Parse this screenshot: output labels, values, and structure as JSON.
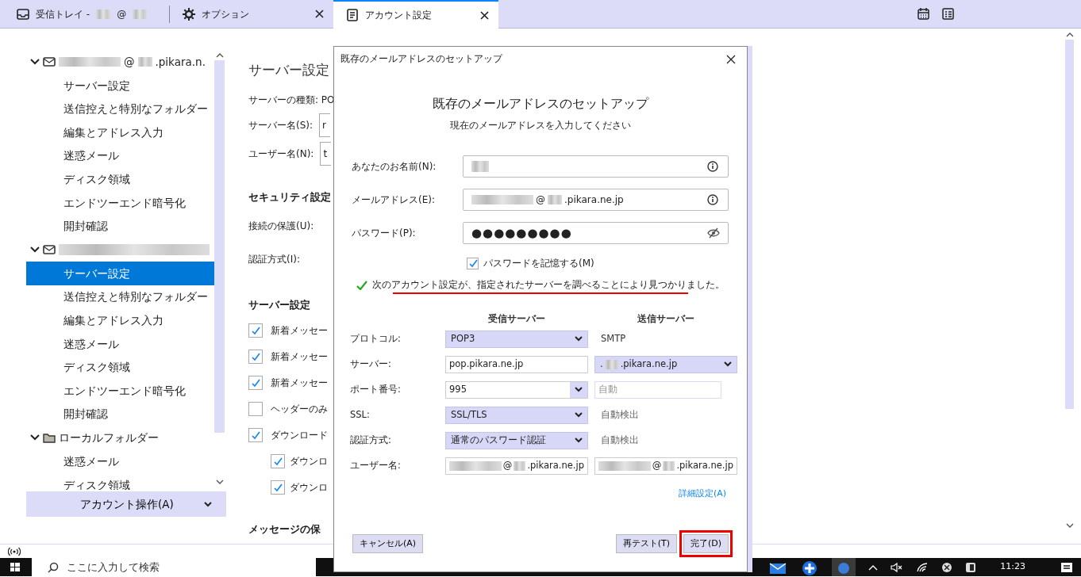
{
  "tabs": [
    {
      "segments": [
        {
          "kind": "text",
          "text": "受信トレイ -"
        },
        {
          "kind": "blur"
        },
        {
          "kind": "text",
          "text": "@"
        },
        {
          "kind": "blur"
        }
      ],
      "closable": false,
      "selected": false
    },
    {
      "segments": [
        {
          "kind": "text",
          "text": "オプション"
        }
      ],
      "closable": true,
      "selected": false
    },
    {
      "segments": [
        {
          "kind": "text",
          "text": "アカウント設定"
        }
      ],
      "closable": true,
      "selected": true
    }
  ],
  "sidebar": {
    "tree": [
      {
        "kind": "account",
        "expanded": true,
        "segments": [
          {
            "kind": "blur"
          },
          {
            "kind": "text",
            "text": "@"
          },
          {
            "kind": "blur"
          },
          {
            "kind": "text",
            "text": ".pikara.n."
          }
        ],
        "children": [
          {
            "label": "サーバー設定",
            "selected": false
          },
          {
            "label": "送信控えと特別なフォルダー",
            "selected": false
          },
          {
            "label": "編集とアドレス入力",
            "selected": false
          },
          {
            "label": "迷惑メール",
            "selected": false
          },
          {
            "label": "ディスク領域",
            "selected": false
          },
          {
            "label": "エンドツーエンド暗号化",
            "selected": false
          },
          {
            "label": "開封確認",
            "selected": false
          }
        ]
      },
      {
        "kind": "account",
        "expanded": true,
        "segments": [
          {
            "kind": "blur"
          }
        ],
        "children": [
          {
            "label": "サーバー設定",
            "selected": true
          },
          {
            "label": "送信控えと特別なフォルダー",
            "selected": false
          },
          {
            "label": "編集とアドレス入力",
            "selected": false
          },
          {
            "label": "迷惑メール",
            "selected": false
          },
          {
            "label": "ディスク領域",
            "selected": false
          },
          {
            "label": "エンドツーエンド暗号化",
            "selected": false
          },
          {
            "label": "開封確認",
            "selected": false
          }
        ]
      },
      {
        "kind": "folder",
        "expanded": true,
        "segments": [
          {
            "kind": "text",
            "text": "ローカルフォルダー"
          }
        ],
        "children": [
          {
            "label": "迷惑メール",
            "selected": false
          },
          {
            "label": "ディスク領域",
            "selected": false
          }
        ]
      }
    ],
    "action_button": "アカウント操作(A)"
  },
  "content": [
    {
      "kind": "title",
      "text": "サーバー設定"
    },
    {
      "kind": "text",
      "text": "サーバーの種類: PO"
    },
    {
      "kind": "field",
      "label": "サーバー名(S):",
      "value": "r"
    },
    {
      "kind": "field",
      "label": "ユーザー名(N):",
      "value": "t"
    },
    {
      "kind": "section",
      "text": "セキュリティ設定"
    },
    {
      "kind": "label",
      "text": "接続の保護(U):"
    },
    {
      "kind": "label",
      "text": "認証方式(I):"
    },
    {
      "kind": "section",
      "text": "サーバー設定"
    },
    {
      "kind": "checkbox",
      "text": "新着メッセー",
      "checked": true
    },
    {
      "kind": "checkbox",
      "text": "新着メッセー",
      "checked": true
    },
    {
      "kind": "checkbox",
      "text": "新着メッセー",
      "checked": true
    },
    {
      "kind": "checkbox",
      "text": "ヘッダーのみ",
      "checked": false
    },
    {
      "kind": "checkbox",
      "text": "ダウンロード",
      "checked": true
    },
    {
      "kind": "subcheckbox",
      "text": "ダウンロ",
      "checked": true
    },
    {
      "kind": "subcheckbox",
      "text": "ダウンロ",
      "checked": true
    },
    {
      "kind": "section",
      "text": "メッセージの保"
    }
  ],
  "dialog": {
    "title": "既存のメールアドレスのセットアップ",
    "heading": "既存のメールアドレスのセットアップ",
    "subtitle": "現在のメールアドレスを入力してください",
    "fields": [
      {
        "label": "あなたのお名前(N):",
        "segments": [
          {
            "kind": "blur"
          }
        ],
        "kind": "info"
      },
      {
        "label": "メールアドレス(E):",
        "segments": [
          {
            "kind": "blur"
          },
          {
            "kind": "text",
            "text": "@"
          },
          {
            "kind": "blur"
          },
          {
            "kind": "text",
            "text": ".pikara.ne.jp"
          }
        ],
        "kind": "info"
      },
      {
        "label": "パスワード(P):",
        "segments": [
          {
            "kind": "text",
            "text": "●●●●●●●●●"
          }
        ],
        "kind": "password"
      }
    ],
    "remember": {
      "label": "パスワードを記憶する(M)",
      "checked": true
    },
    "message": {
      "text": "次のアカウント設定が、指定されたサーバーを調べることにより見つかりました。",
      "underlined": true
    },
    "server_table": {
      "columns": [
        "受信サーバー",
        "送信サーバー"
      ],
      "rows": [
        {
          "label": "プロトコル:",
          "cells": [
            {
              "kind": "select",
              "segments": [
                {
                  "kind": "text",
                  "text": "POP3"
                }
              ]
            },
            {
              "kind": "text",
              "segments": [
                {
                  "kind": "text",
                  "text": "SMTP"
                }
              ]
            }
          ]
        },
        {
          "label": "サーバー:",
          "cells": [
            {
              "kind": "input",
              "segments": [
                {
                  "kind": "text",
                  "text": "pop.pikara.ne.jp"
                }
              ]
            },
            {
              "kind": "select",
              "segments": [
                {
                  "kind": "text",
                  "text": "."
                },
                {
                  "kind": "blur"
                },
                {
                  "kind": "text",
                  "text": ".pikara.ne.jp"
                }
              ]
            }
          ]
        },
        {
          "label": "ポート番号:",
          "cells": [
            {
              "kind": "combo",
              "segments": [
                {
                  "kind": "text",
                  "text": "995"
                }
              ]
            },
            {
              "kind": "placeholder-input",
              "placeholder": "自動"
            }
          ]
        },
        {
          "label": "SSL:",
          "cells": [
            {
              "kind": "select",
              "segments": [
                {
                  "kind": "text",
                  "text": "SSL/TLS"
                }
              ]
            },
            {
              "kind": "text",
              "segments": [
                {
                  "kind": "text",
                  "text": "自動検出"
                }
              ]
            }
          ]
        },
        {
          "label": "認証方式:",
          "cells": [
            {
              "kind": "select",
              "segments": [
                {
                  "kind": "text",
                  "text": "通常のパスワード認証"
                }
              ]
            },
            {
              "kind": "text",
              "segments": [
                {
                  "kind": "text",
                  "text": "自動検出"
                }
              ]
            }
          ]
        },
        {
          "label": "ユーザー名:",
          "cells": [
            {
              "kind": "input",
              "segments": [
                {
                  "kind": "blur"
                },
                {
                  "kind": "text",
                  "text": "@"
                },
                {
                  "kind": "blur"
                },
                {
                  "kind": "text",
                  "text": ".pikara.ne.jp"
                }
              ]
            },
            {
              "kind": "input",
              "segments": [
                {
                  "kind": "blur"
                },
                {
                  "kind": "text",
                  "text": "@"
                },
                {
                  "kind": "blur"
                },
                {
                  "kind": "text",
                  "text": ".pikara.ne.jp"
                }
              ]
            }
          ]
        }
      ]
    },
    "advanced_link": "詳細設定(A)",
    "cancel_button": "キャンセル(A)",
    "buttons": [
      {
        "label": "再テスト(T)",
        "highlighted": false
      },
      {
        "label": "完了(D)",
        "highlighted": true
      }
    ]
  },
  "taskbar": {
    "search_placeholder": "ここに入力して検索",
    "clock": "11:23"
  }
}
